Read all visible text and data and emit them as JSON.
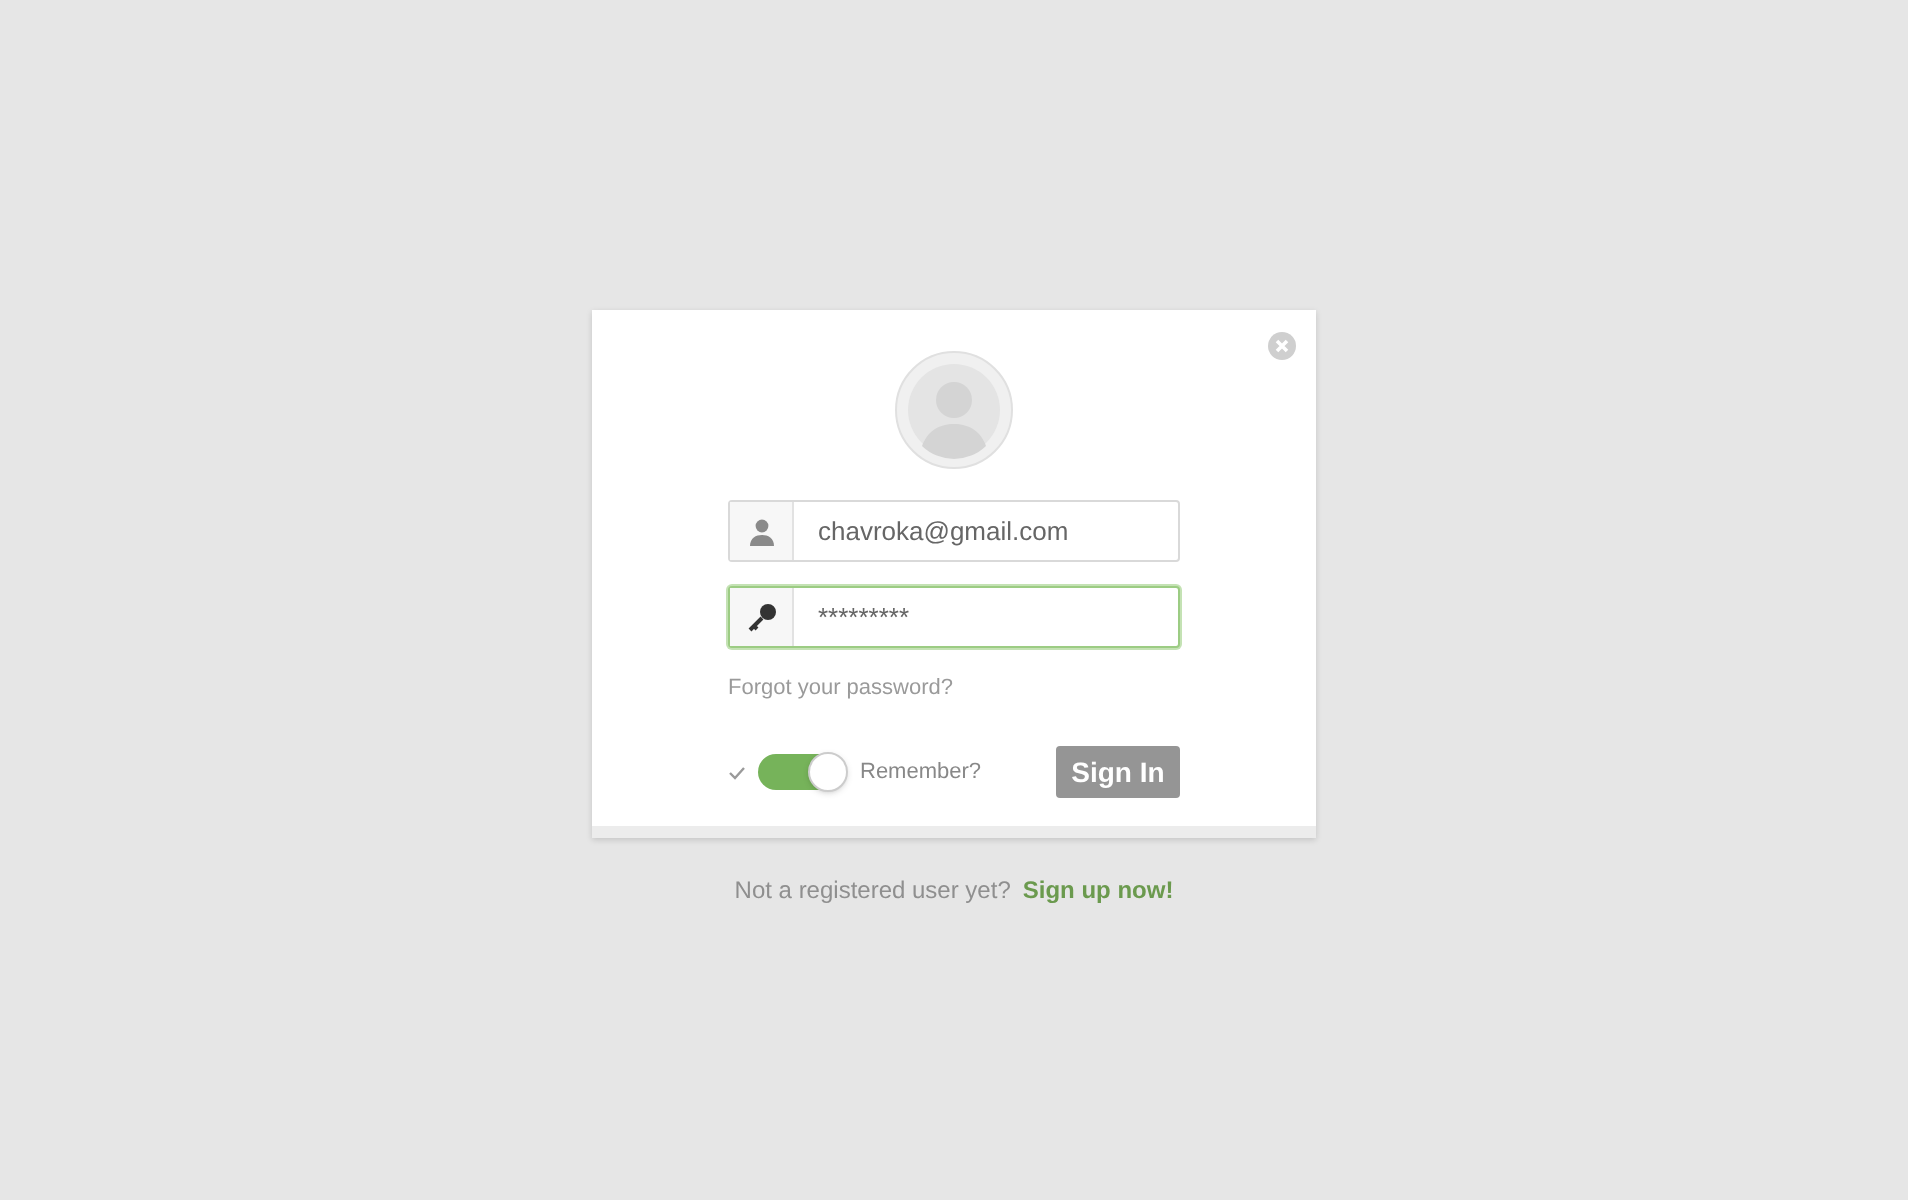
{
  "login": {
    "email": {
      "value": "chavroka@gmail.com",
      "focused": false
    },
    "password": {
      "value": "*********",
      "focused": true
    },
    "forgot_link": "Forgot your password?",
    "remember": {
      "label": "Remember?",
      "on": true
    },
    "sign_in": {
      "label": "Sign In",
      "disabled": true
    }
  },
  "footer": {
    "text": "Not a registered user yet?",
    "link": "Sign up now!"
  }
}
